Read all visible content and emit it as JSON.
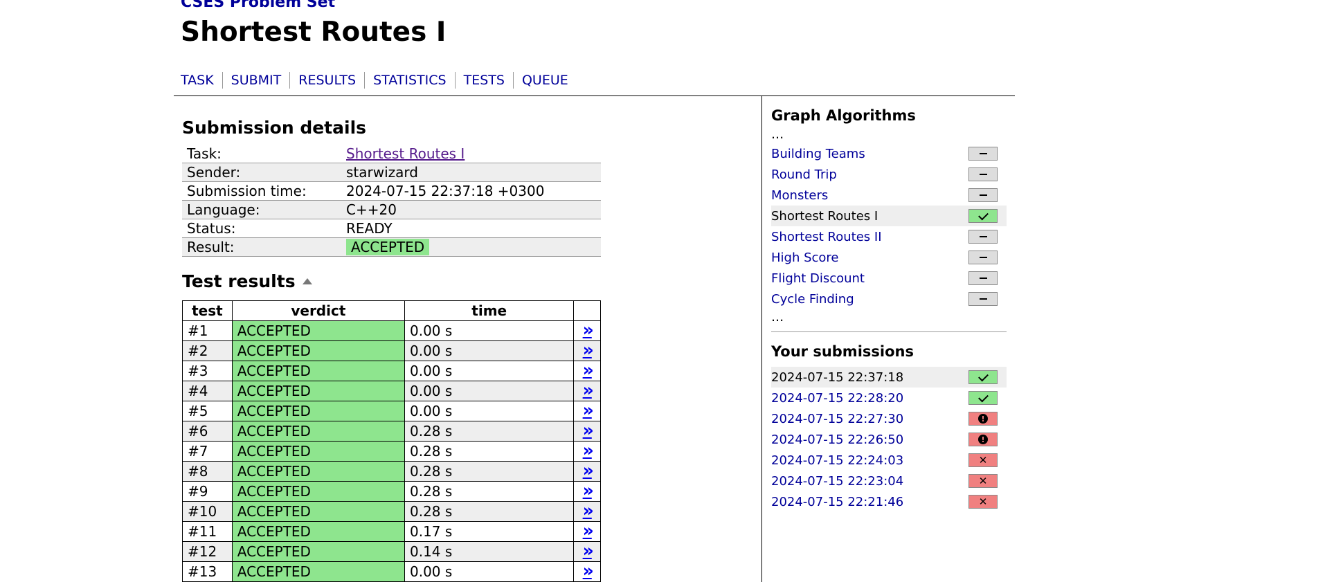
{
  "site": {
    "title": "CSES Problem Set"
  },
  "task": {
    "title": "Shortest Routes I"
  },
  "nav": [
    "TASK",
    "SUBMIT",
    "RESULTS",
    "STATISTICS",
    "TESTS",
    "QUEUE"
  ],
  "submission": {
    "heading": "Submission details",
    "rows": [
      {
        "label": "Task:",
        "value": "Shortest Routes I"
      },
      {
        "label": "Sender:",
        "value": "starwizard"
      },
      {
        "label": "Submission time:",
        "value": "2024-07-15 22:37:18 +0300"
      },
      {
        "label": "Language:",
        "value": "C++20"
      },
      {
        "label": "Status:",
        "value": "READY"
      },
      {
        "label": "Result:",
        "value": "ACCEPTED"
      }
    ]
  },
  "tests": {
    "heading": "Test results",
    "columns": [
      "test",
      "verdict",
      "time",
      ""
    ],
    "link_glyph": "»",
    "rows": [
      {
        "id": "#1",
        "verdict": "ACCEPTED",
        "time": "0.00 s"
      },
      {
        "id": "#2",
        "verdict": "ACCEPTED",
        "time": "0.00 s"
      },
      {
        "id": "#3",
        "verdict": "ACCEPTED",
        "time": "0.00 s"
      },
      {
        "id": "#4",
        "verdict": "ACCEPTED",
        "time": "0.00 s"
      },
      {
        "id": "#5",
        "verdict": "ACCEPTED",
        "time": "0.00 s"
      },
      {
        "id": "#6",
        "verdict": "ACCEPTED",
        "time": "0.28 s"
      },
      {
        "id": "#7",
        "verdict": "ACCEPTED",
        "time": "0.28 s"
      },
      {
        "id": "#8",
        "verdict": "ACCEPTED",
        "time": "0.28 s"
      },
      {
        "id": "#9",
        "verdict": "ACCEPTED",
        "time": "0.28 s"
      },
      {
        "id": "#10",
        "verdict": "ACCEPTED",
        "time": "0.28 s"
      },
      {
        "id": "#11",
        "verdict": "ACCEPTED",
        "time": "0.17 s"
      },
      {
        "id": "#12",
        "verdict": "ACCEPTED",
        "time": "0.14 s"
      },
      {
        "id": "#13",
        "verdict": "ACCEPTED",
        "time": "0.00 s"
      }
    ]
  },
  "sidebar": {
    "category": "Graph Algorithms",
    "ellipsis": "...",
    "tasks": [
      {
        "name": "Building Teams",
        "status": "none",
        "current": false
      },
      {
        "name": "Round Trip",
        "status": "none",
        "current": false
      },
      {
        "name": "Monsters",
        "status": "none",
        "current": false
      },
      {
        "name": "Shortest Routes I",
        "status": "ok",
        "current": true
      },
      {
        "name": "Shortest Routes II",
        "status": "none",
        "current": false
      },
      {
        "name": "High Score",
        "status": "none",
        "current": false
      },
      {
        "name": "Flight Discount",
        "status": "none",
        "current": false
      },
      {
        "name": "Cycle Finding",
        "status": "none",
        "current": false
      }
    ],
    "submissions_heading": "Your submissions",
    "submissions": [
      {
        "time": "2024-07-15 22:37:18",
        "status": "ok",
        "current": true
      },
      {
        "time": "2024-07-15 22:28:20",
        "status": "ok",
        "current": false
      },
      {
        "time": "2024-07-15 22:27:30",
        "status": "error",
        "current": false
      },
      {
        "time": "2024-07-15 22:26:50",
        "status": "error",
        "current": false
      },
      {
        "time": "2024-07-15 22:24:03",
        "status": "wrong",
        "current": false
      },
      {
        "time": "2024-07-15 22:23:04",
        "status": "wrong",
        "current": false
      },
      {
        "time": "2024-07-15 22:21:46",
        "status": "wrong",
        "current": false
      }
    ]
  },
  "colors": {
    "accepted": "#8ee58e",
    "failed": "#f08080",
    "link": "#000099",
    "neutral": "#dddddd"
  },
  "icons": {
    "ok": "checkmark-icon",
    "none": "dash-icon",
    "error": "exclamation-icon",
    "wrong": "cross-icon",
    "sort": "sort-ascending-icon",
    "view": "double-chevron-right-icon"
  }
}
